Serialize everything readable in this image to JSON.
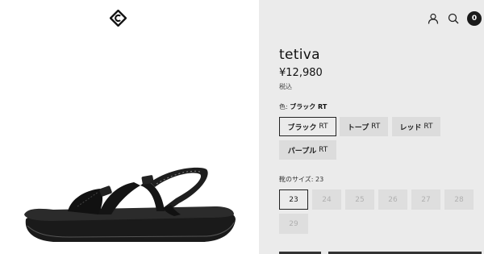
{
  "product": {
    "title": "tetiva",
    "price": "¥12,980",
    "tax_note": "税込"
  },
  "color_option": {
    "label_prefix": "色: ",
    "selected_value": "ブラック RT",
    "choices": [
      {
        "jp": "ブラック",
        "suffix": "RT",
        "selected": true
      },
      {
        "jp": "トープ",
        "suffix": "RT",
        "selected": false
      },
      {
        "jp": "レッド",
        "suffix": "RT",
        "selected": false
      },
      {
        "jp": "パープル",
        "suffix": "RT",
        "selected": false
      }
    ]
  },
  "size_option": {
    "label": "靴のサイズ: 23",
    "choices": [
      {
        "label": "23",
        "selected": true,
        "available": true
      },
      {
        "label": "24",
        "selected": false,
        "available": false
      },
      {
        "label": "25",
        "selected": false,
        "available": false
      },
      {
        "label": "26",
        "selected": false,
        "available": false
      },
      {
        "label": "27",
        "selected": false,
        "available": false
      },
      {
        "label": "28",
        "selected": false,
        "available": false
      },
      {
        "label": "29",
        "selected": false,
        "available": false
      }
    ]
  },
  "header": {
    "cart_count": "0",
    "icons": [
      "account-icon",
      "search-icon",
      "cart-icon"
    ]
  },
  "colors": {
    "panel_bg": "#ebebeb",
    "accent": "#1a1a1a"
  }
}
